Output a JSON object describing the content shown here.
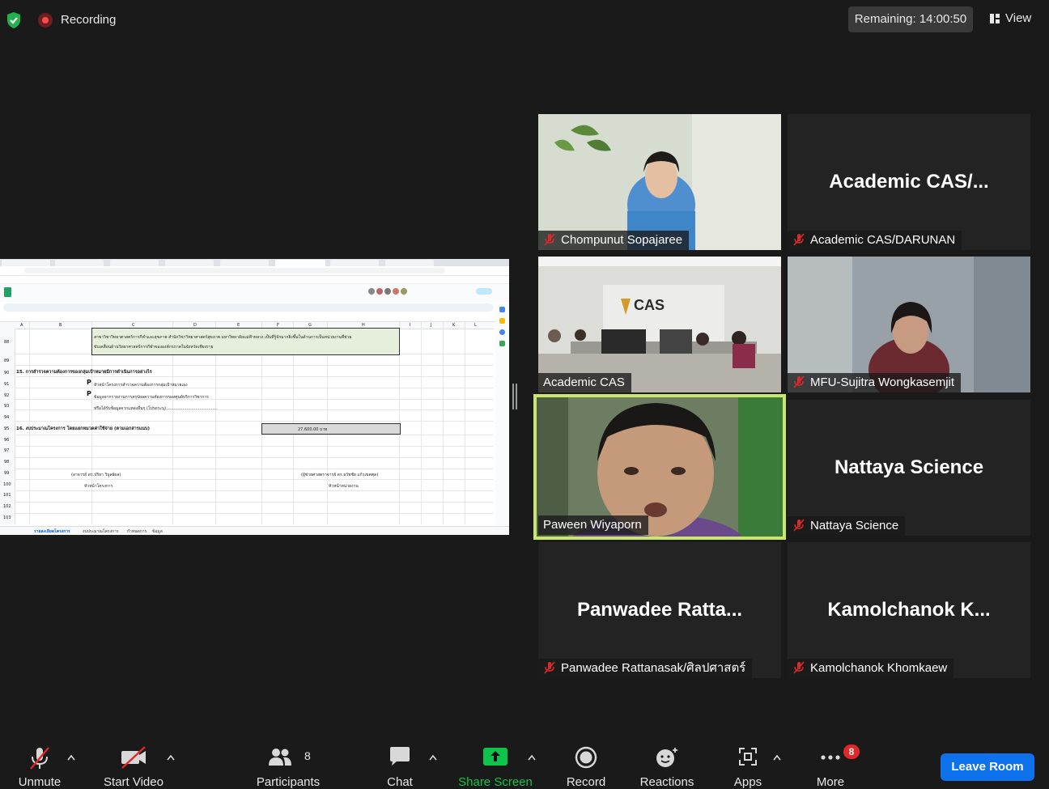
{
  "top": {
    "recording_label": "Recording",
    "remaining": "Remaining: 14:00:50",
    "view_label": "View"
  },
  "shared_screen": {
    "section_15": "15. การสำรวจความต้องการของกลุ่มเป้าหมายมีการดำเนินการอย่างไร",
    "line_a": "หัวหน้าโครงการสำรวจความต้องการกลุ่มเป้าหมายเอง",
    "line_b": "ข้อมูลจากรายงานการสรุปผลความต้องการของศูนย์บริการวิชาการ",
    "line_c": "หรือได้รับข้อมูลจากแหล่งอื่นๆ (โปรดระบุ)........................................",
    "section_16": "16. งบประมาณโครงการ โดยแยกหมวดค่าใช้จ่าย (ตามเอกสารแนบ)",
    "budget": "27,600.00    บาท",
    "sign_left": "(อาจารย์ ดร.ปริยา วิบูลย์ผล)",
    "role_left": "หัวหน้าโครงการ",
    "sign_right": "(ผู้ช่วยศาสตราจารย์ ดร.ธวัชชัย แก้วเขตตุด)",
    "role_right": "หัวหน้าหน่วยงาน",
    "box_line1": "สาขาวิชาวิทยาศาสตร์การกีฬาและสุขภาพ สำนักวิชาวิทยาศาสตร์สุขภาพ มหาวิทยาลัยแม่ฟ้าหลวง เป็นที่รู้จักมากยิ่งขึ้นในด้านการเป็นหน่วยงานที่ช่วย",
    "box_line2": "ขับเคลื่อนด้านวิทยาศาสตร์การกีฬาขององค์กรภาคในจังหวัดเชียงราย",
    "row_numbers": [
      "88",
      "89",
      "90",
      "91",
      "92",
      "93",
      "94",
      "95",
      "96",
      "97",
      "98",
      "99",
      "100",
      "101",
      "102",
      "103"
    ],
    "col_letters": [
      "A",
      "B",
      "C",
      "D",
      "E",
      "F",
      "G",
      "H",
      "I",
      "J",
      "K",
      "L"
    ],
    "sheet_tabs": [
      "รายละเอียดโครงการ",
      "งบประมาณโครงการ",
      "กำหนดการ",
      "ข้อมูล"
    ]
  },
  "tiles": [
    {
      "name": "Chompunut Sopajaree",
      "big": "",
      "muted": true,
      "type": "video-woman"
    },
    {
      "name": "Academic CAS/DARUNAN",
      "big": "Academic  CAS/...",
      "muted": true,
      "type": "text"
    },
    {
      "name": "Academic CAS",
      "big": "",
      "muted": false,
      "type": "video-room"
    },
    {
      "name": "MFU-Sujitra Wongkasemjit",
      "big": "",
      "muted": true,
      "type": "video-woman2"
    },
    {
      "name": "Paween Wiyaporn",
      "big": "",
      "muted": false,
      "type": "video-man",
      "active": true
    },
    {
      "name": "Nattaya Science",
      "big": "Nattaya Science",
      "muted": true,
      "type": "text"
    },
    {
      "name": "Panwadee Rattanasak/ศิลปศาสตร์",
      "big": "Panwadee  Ratta...",
      "muted": true,
      "type": "text"
    },
    {
      "name": "Kamolchanok Khomkaew",
      "big": "Kamolchanok  K...",
      "muted": true,
      "type": "text"
    }
  ],
  "toolbar": {
    "unmute": "Unmute",
    "start_video": "Start Video",
    "participants": "Participants",
    "participants_count": "8",
    "chat": "Chat",
    "share_screen": "Share Screen",
    "record": "Record",
    "reactions": "Reactions",
    "apps": "Apps",
    "more": "More",
    "more_badge": "8",
    "leave": "Leave Room"
  },
  "colors": {
    "share_green": "#0ec44a",
    "leave_blue": "#0e72ed",
    "active_border": "#c9e66e",
    "badge_red": "#e02828"
  }
}
